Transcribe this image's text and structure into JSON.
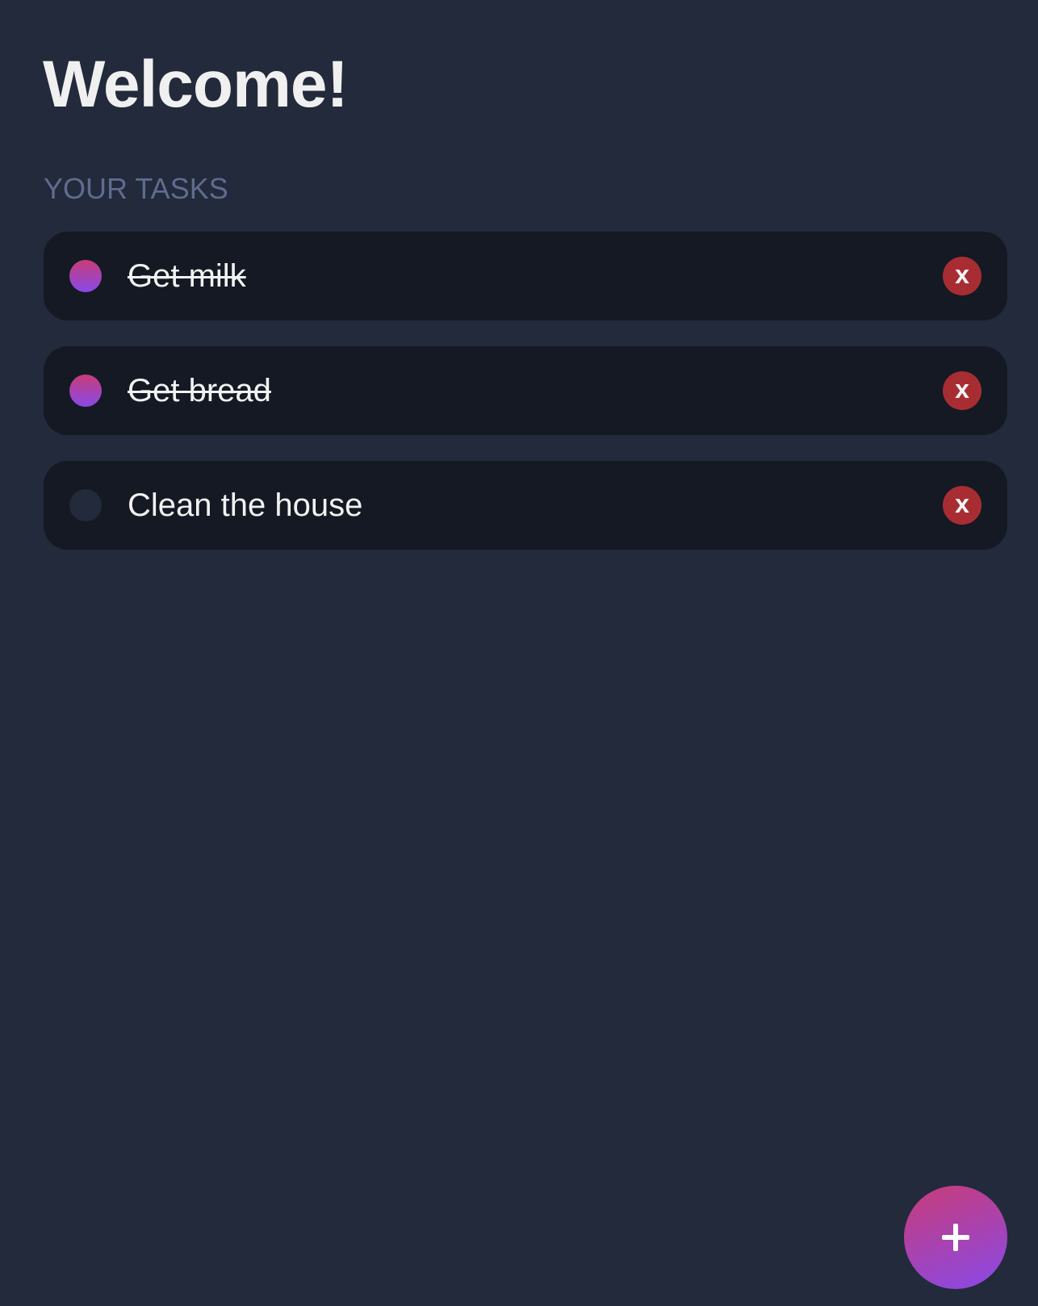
{
  "header": {
    "title": "Welcome!"
  },
  "tasks_section": {
    "label": "YOUR TASKS",
    "items": [
      {
        "text": "Get milk",
        "completed": true,
        "delete_label": "x"
      },
      {
        "text": "Get bread",
        "completed": true,
        "delete_label": "x"
      },
      {
        "text": "Clean the house",
        "completed": false,
        "delete_label": "x"
      }
    ]
  },
  "add_button": {
    "icon": "plus-icon"
  },
  "colors": {
    "background": "#222a3b",
    "card": "#141923",
    "accent_start": "#c93c78",
    "accent_end": "#8849e8",
    "delete": "#a82d33"
  }
}
